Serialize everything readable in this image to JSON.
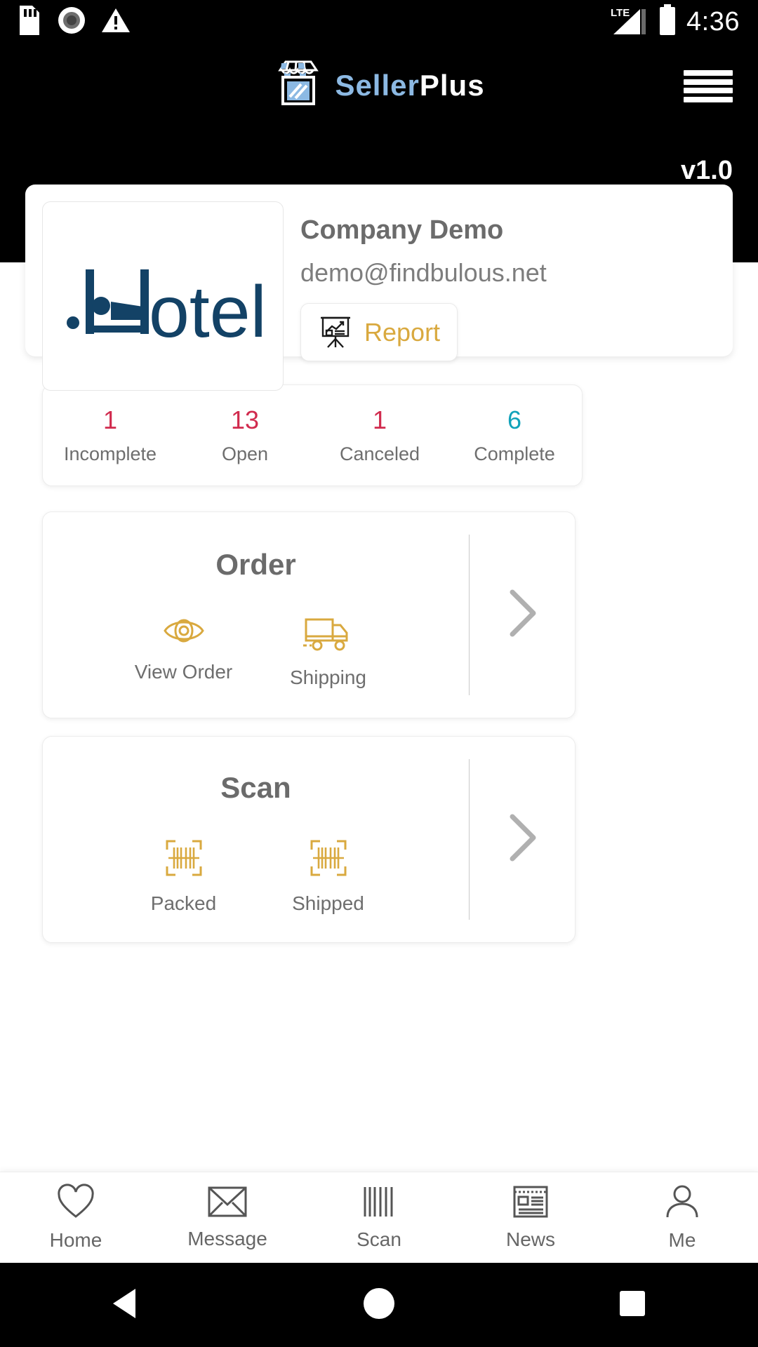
{
  "statusbar": {
    "time": "4:36",
    "icons": [
      "sd-card-icon",
      "record-icon",
      "warning-icon"
    ],
    "right_icons": [
      "lte-signal-icon",
      "battery-icon"
    ],
    "network_label": "LTE"
  },
  "header": {
    "brand_part1": "Seller",
    "brand_part2": "Plus",
    "version": "v1.0",
    "menu_icon": "hamburger-menu-icon"
  },
  "profile": {
    "logo_text": "Hotel",
    "company_name": "Company Demo",
    "email": "demo@findbulous.net",
    "report_label": "Report",
    "report_icon": "presentation-chart-icon"
  },
  "stats": [
    {
      "value": "1",
      "label": "Incomplete",
      "color": "#d12b4e"
    },
    {
      "value": "13",
      "label": "Open",
      "color": "#d12b4e"
    },
    {
      "value": "1",
      "label": "Canceled",
      "color": "#d12b4e"
    },
    {
      "value": "6",
      "label": "Complete",
      "color": "#11a2ba"
    }
  ],
  "order_card": {
    "title": "Order",
    "items": [
      {
        "label": "View Order",
        "icon": "eye-icon"
      },
      {
        "label": "Shipping",
        "icon": "truck-icon"
      }
    ],
    "arrow_icon": "chevron-right-icon"
  },
  "scan_card": {
    "title": "Scan",
    "items": [
      {
        "label": "Packed",
        "icon": "barcode-scan-icon"
      },
      {
        "label": "Shipped",
        "icon": "barcode-scan-icon"
      }
    ],
    "arrow_icon": "chevron-right-icon"
  },
  "bottom_nav": [
    {
      "label": "Home",
      "icon": "heart-icon"
    },
    {
      "label": "Message",
      "icon": "envelope-icon"
    },
    {
      "label": "Scan",
      "icon": "barcode-icon"
    },
    {
      "label": "News",
      "icon": "news-list-icon"
    },
    {
      "label": "Me",
      "icon": "person-icon"
    }
  ],
  "system_nav": [
    {
      "icon": "back-triangle-icon"
    },
    {
      "icon": "home-circle-icon"
    },
    {
      "icon": "recents-square-icon"
    }
  ],
  "colors": {
    "accent_gold": "#d9a93f",
    "brand_blue": "#8cb9e3",
    "logo_navy": "#134266",
    "red": "#d12b4e",
    "teal": "#11a2ba"
  }
}
